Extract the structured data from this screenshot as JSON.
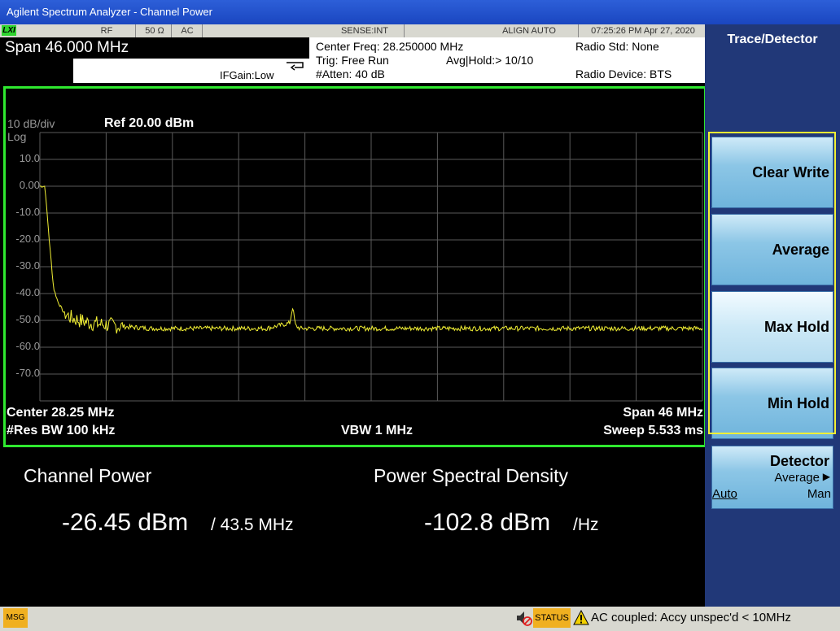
{
  "window": {
    "title": "Agilent Spectrum Analyzer - Channel Power"
  },
  "status_bar": {
    "lxi": "LXI",
    "rf": "RF",
    "impedance": "50 Ω",
    "coupling": "AC",
    "sense": "SENSE:INT",
    "align": "ALIGN AUTO",
    "datetime": "07:25:26 PM Apr 27, 2020"
  },
  "info": {
    "span": "Span 46.000 MHz",
    "ifgain": "IFGain:Low",
    "center_freq": "Center Freq: 28.250000 MHz",
    "trig": "Trig: Free Run",
    "avg_hold": "Avg|Hold:> 10/10",
    "atten": "#Atten: 40 dB",
    "radio_std": "Radio Std: None",
    "radio_device": "Radio Device: BTS"
  },
  "plot": {
    "scale": "10 dB/div",
    "log": "Log",
    "ref": "Ref 20.00 dBm",
    "yticks": [
      "10.0",
      "0.00",
      "-10.0",
      "-20.0",
      "-30.0",
      "-40.0",
      "-50.0",
      "-60.0",
      "-70.0"
    ],
    "center": "Center  28.25 MHz",
    "span": "Span 46 MHz",
    "res_bw": "#Res BW  100 kHz",
    "vbw": "VBW  1 MHz",
    "sweep": "Sweep  5.533 ms",
    "trace_color": "#f2f034",
    "grid_color": "#5a5a5a"
  },
  "chart_data": {
    "type": "line",
    "xlabel": "",
    "ylabel": "",
    "x_range_mhz": [
      5.25,
      51.25
    ],
    "ylim": [
      -80,
      20
    ],
    "series": [
      {
        "x": [
          5.25,
          5.6,
          5.9,
          6.2,
          6.5,
          6.9,
          7.4,
          8.0,
          8.8,
          9.6,
          10.5,
          11.5,
          13,
          15,
          17,
          19,
          21,
          22.6,
          22.8,
          23.0,
          23.3,
          25,
          27,
          29,
          32,
          35,
          38,
          40,
          42,
          44,
          46,
          48,
          50,
          51.25
        ],
        "y": [
          0,
          0,
          -20,
          -38,
          -43,
          -47,
          -49,
          -50,
          -51,
          -51.5,
          -52,
          -52.5,
          -53,
          -53,
          -53,
          -53,
          -53,
          -51,
          -45,
          -52,
          -53,
          -53,
          -53,
          -53,
          -53,
          -53,
          -53,
          -53,
          -53,
          -53,
          -53,
          -53,
          -53,
          -53
        ]
      }
    ]
  },
  "results": {
    "channel_power_label": "Channel Power",
    "channel_power_value": "-26.45 dBm",
    "channel_power_bw": "/ 43.5 MHz",
    "psd_label": "Power Spectral Density",
    "psd_value": "-102.8 dBm",
    "psd_unit": "/Hz"
  },
  "menu": {
    "title": "Trace/Detector",
    "keys": [
      "Clear Write",
      "Average",
      "Max Hold",
      "Min Hold"
    ],
    "detector": {
      "label": "Detector",
      "value": "Average",
      "auto": "Auto",
      "man": "Man"
    }
  },
  "bottom": {
    "msg": "MSG",
    "status": "STATUS",
    "warning": "AC coupled: Accy unspec'd < 10MHz"
  }
}
